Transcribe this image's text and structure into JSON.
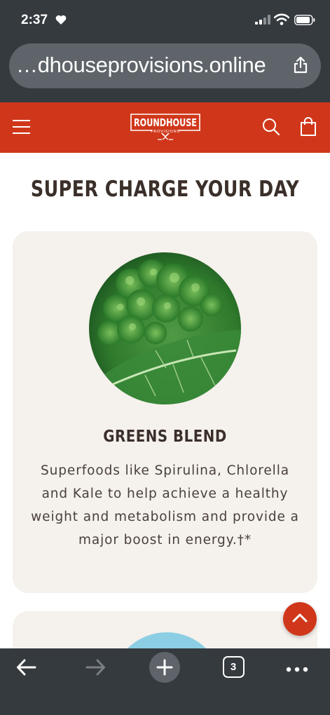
{
  "status_bar": {
    "time": "2:37",
    "icons": [
      "heart-icon",
      "signal-icon",
      "wifi-icon",
      "battery-icon"
    ]
  },
  "browser": {
    "url": "…dhouseprovisions.online",
    "share_icon": "share-icon",
    "toolbar": {
      "back_icon": "back-arrow-icon",
      "forward_icon": "forward-arrow-icon",
      "new_tab_icon": "plus-icon",
      "tab_count": "3",
      "more_icon": "more-dots-icon"
    }
  },
  "header": {
    "logo_text": "ROUNDHOUSE",
    "logo_subtext": "PROVISIONS",
    "menu_icon": "hamburger-icon",
    "search_icon": "search-icon",
    "cart_icon": "shopping-bag-icon",
    "brand_color": "#d0371a"
  },
  "main": {
    "title": "SUPER CHARGE YOUR DAY",
    "cards": [
      {
        "image": "kale-leaves-photo",
        "title": "GREENS BLEND",
        "description": "Superfoods like Spirulina, Chlorella and Kale to help achieve a healthy weight and metabolism and provide a major boost in energy.†*"
      }
    ],
    "scroll_top_icon": "chevron-up-icon"
  },
  "colors": {
    "chrome": "#353a3f",
    "card_bg": "#f5f1ec",
    "heading": "#3b2f2a"
  }
}
